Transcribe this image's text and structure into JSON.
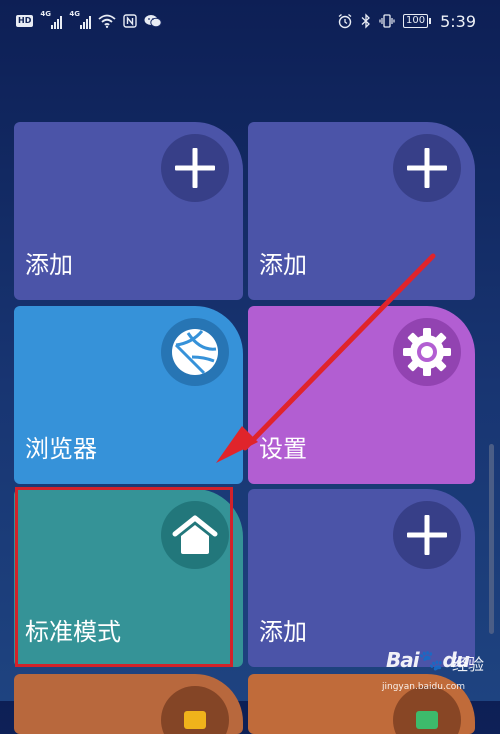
{
  "status_bar": {
    "hd": "HD",
    "sim1_network": "4G",
    "sim2_network": "4G",
    "battery": "100",
    "time": "5:39",
    "left_icons": [
      "hd-icon",
      "signal-icon",
      "signal-icon",
      "wifi-icon",
      "nfc-icon",
      "wechat-icon"
    ],
    "right_icons": [
      "alarm-icon",
      "bluetooth-icon",
      "vibrate-icon",
      "battery-icon"
    ]
  },
  "tiles": {
    "add_top_left": {
      "label": "添加",
      "icon": "plus-icon"
    },
    "add_top_right": {
      "label": "添加",
      "icon": "plus-icon"
    },
    "browser": {
      "label": "浏览器",
      "icon": "globe-icon"
    },
    "settings": {
      "label": "设置",
      "icon": "gear-icon"
    },
    "standard_mode": {
      "label": "标准模式",
      "icon": "home-icon"
    },
    "add_bottom_right": {
      "label": "添加",
      "icon": "plus-icon"
    }
  },
  "annotation": {
    "arrow_color": "#e0242b",
    "highlight_color": "#d2222a",
    "highlighted_tile": "standard_mode"
  },
  "watermark": {
    "brand": "Bai",
    "brand_suffix": "du",
    "cn": "经验",
    "url": "jingyan.baidu.com"
  },
  "colors": {
    "background_top": "#0d1f55",
    "background_bottom": "#1e4380",
    "tile_add": "#4b54a8",
    "tile_browser": "#3692d9",
    "tile_settings": "#b25ed2",
    "tile_standard": "#359397",
    "tile_orange": "#b8683d"
  }
}
